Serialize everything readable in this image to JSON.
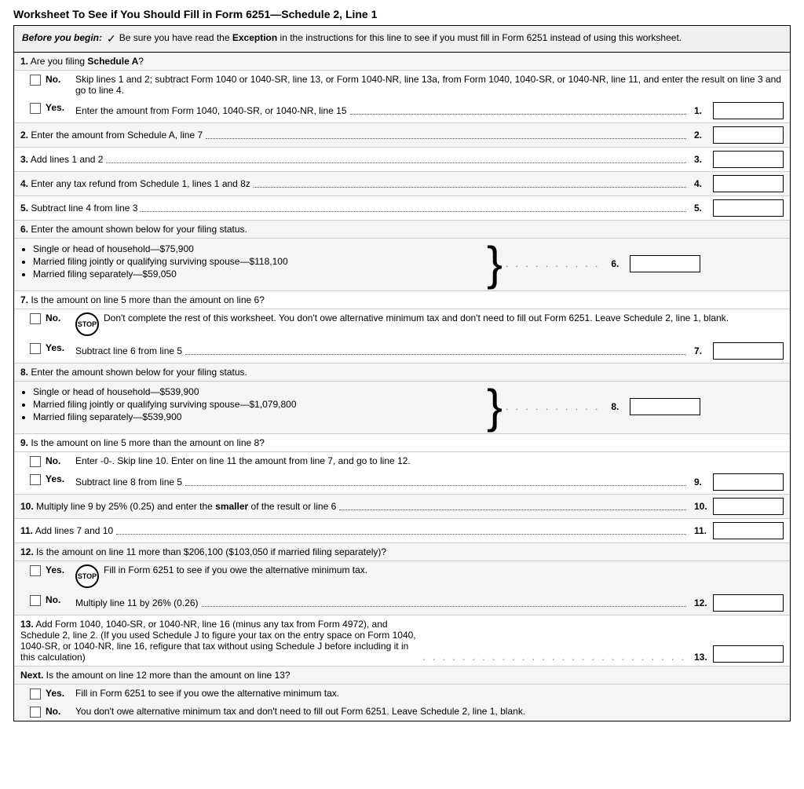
{
  "title": "Worksheet To See if You Should Fill in Form 6251—Schedule 2, Line 1",
  "before_begin": {
    "label": "Before you begin:",
    "text": "Be sure you have read the Exception in the instructions for this line to see if you must fill in Form 6251 instead of using this worksheet."
  },
  "questions": [
    {
      "number": "1.",
      "text": "Are you filing Schedule A?",
      "no_text": "Skip lines 1 and 2; subtract Form 1040 or 1040-SR, line 13, or Form 1040-NR, line 13a, from Form 1040, 1040-SR, or 1040-NR, line 11, and enter the result on line 3 and go to line 4.",
      "yes_text": "Enter the amount from Form 1040, 1040-SR, or 1040-NR, line 15",
      "line_num": "1."
    },
    {
      "number": "2.",
      "text": "Enter the amount from Schedule A, line 7",
      "line_num": "2."
    },
    {
      "number": "3.",
      "text": "Add lines 1 and 2",
      "line_num": "3."
    },
    {
      "number": "4.",
      "text": "Enter any tax refund from Schedule 1, lines 1 and 8z",
      "line_num": "4."
    },
    {
      "number": "5.",
      "text": "Subtract line 4 from line 3",
      "line_num": "5."
    },
    {
      "number": "6.",
      "text": "Enter the amount shown below for your filing status.",
      "bullets": [
        "Single or head of household—$75,900",
        "Married filing jointly or qualifying surviving spouse—$118,100",
        "Married filing separately—$59,050"
      ],
      "line_num": "6."
    },
    {
      "number": "7.",
      "text": "Is the amount on line 5 more than the amount on line 6?",
      "no_stop": true,
      "no_stop_text": "Don't complete the rest of this worksheet. You don't owe alternative minimum tax and don't need to fill out Form 6251. Leave Schedule 2, line 1, blank.",
      "yes_text": "Subtract line 6 from line 5",
      "line_num": "7."
    },
    {
      "number": "8.",
      "text": "Enter the amount shown below for your filing status.",
      "bullets": [
        "Single or head of household—$539,900",
        "Married filing jointly or qualifying surviving spouse—$1,079,800",
        "Married filing separately—$539,900"
      ],
      "line_num": "8."
    },
    {
      "number": "9.",
      "text": "Is the amount on line 5 more than the amount on line 8?",
      "no_text": "Enter -0-. Skip line 10. Enter on line 11 the amount from line 7, and go to line 12.",
      "yes_text": "Subtract line 8 from line 5",
      "line_num": "9."
    },
    {
      "number": "10.",
      "text": "Multiply line 9 by 25% (0.25) and enter the smaller of the result or line 6",
      "line_num": "10."
    },
    {
      "number": "11.",
      "text": "Add lines 7 and 10",
      "line_num": "11."
    },
    {
      "number": "12.",
      "text": "Is the amount on line 11 more than $206,100 ($103,050 if married filing separately)?",
      "yes_stop": true,
      "yes_stop_text": "Fill in Form 6251 to see if you owe the alternative minimum tax.",
      "no_text": "Multiply line 11 by 26% (0.26)",
      "line_num": "12."
    },
    {
      "number": "13.",
      "text": "Add Form 1040, 1040-SR, or 1040-NR, line 16 (minus any tax from Form 4972), and Schedule 2, line 2. (If you used Schedule J to figure your tax on the entry space on Form 1040, 1040-SR, or 1040-NR, line 16, refigure that tax without using Schedule J before including it in this calculation)",
      "line_num": "13."
    }
  ],
  "next_section": {
    "label": "Next.",
    "text": "Is the amount on line 12 more than the amount on line 13?",
    "yes_text": "Fill in Form 6251 to see if you owe the alternative minimum tax.",
    "no_text": "You don't owe alternative minimum tax and don't need to fill out Form 6251. Leave Schedule 2, line 1, blank."
  }
}
